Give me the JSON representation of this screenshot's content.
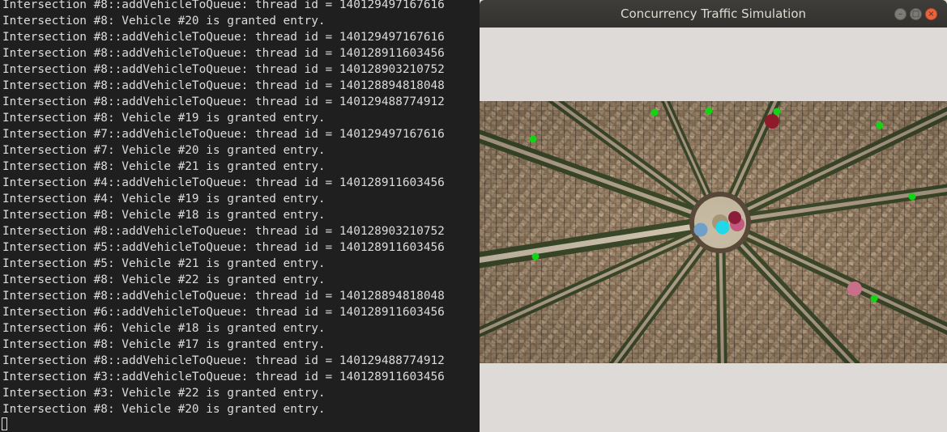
{
  "terminal": {
    "lines": [
      "Intersection #8::addVehicleToQueue: thread id = 140129497167616",
      "Intersection #8: Vehicle #20 is granted entry.",
      "Intersection #8::addVehicleToQueue: thread id = 140129497167616",
      "Intersection #8::addVehicleToQueue: thread id = 140128911603456",
      "Intersection #8::addVehicleToQueue: thread id = 140128903210752",
      "Intersection #8::addVehicleToQueue: thread id = 140128894818048",
      "Intersection #8::addVehicleToQueue: thread id = 140129488774912",
      "Intersection #8: Vehicle #19 is granted entry.",
      "Intersection #7::addVehicleToQueue: thread id = 140129497167616",
      "Intersection #7: Vehicle #20 is granted entry.",
      "Intersection #8: Vehicle #21 is granted entry.",
      "Intersection #4::addVehicleToQueue: thread id = 140128911603456",
      "Intersection #4: Vehicle #19 is granted entry.",
      "Intersection #8: Vehicle #18 is granted entry.",
      "Intersection #8::addVehicleToQueue: thread id = 140128903210752",
      "Intersection #5::addVehicleToQueue: thread id = 140128911603456",
      "Intersection #5: Vehicle #21 is granted entry.",
      "Intersection #8: Vehicle #22 is granted entry.",
      "Intersection #8::addVehicleToQueue: thread id = 140128894818048",
      "Intersection #6::addVehicleToQueue: thread id = 140128911603456",
      "Intersection #6: Vehicle #18 is granted entry.",
      "Intersection #8: Vehicle #17 is granted entry.",
      "Intersection #8::addVehicleToQueue: thread id = 140129488774912",
      "Intersection #3::addVehicleToQueue: thread id = 140128911603456",
      "Intersection #3: Vehicle #22 is granted entry.",
      "Intersection #8: Vehicle #20 is granted entry."
    ]
  },
  "window": {
    "title": "Concurrency Traffic Simulation",
    "controls": {
      "minimize_glyph": "–",
      "maximize_glyph": "□",
      "close_glyph": "×"
    }
  },
  "map": {
    "traffic_light_color": "#12d412",
    "vehicle_colors": [
      "#8e1a2a",
      "#6fa0c8",
      "#22d8e8",
      "#c25a80",
      "#8b1d3a",
      "#c8708a"
    ]
  }
}
